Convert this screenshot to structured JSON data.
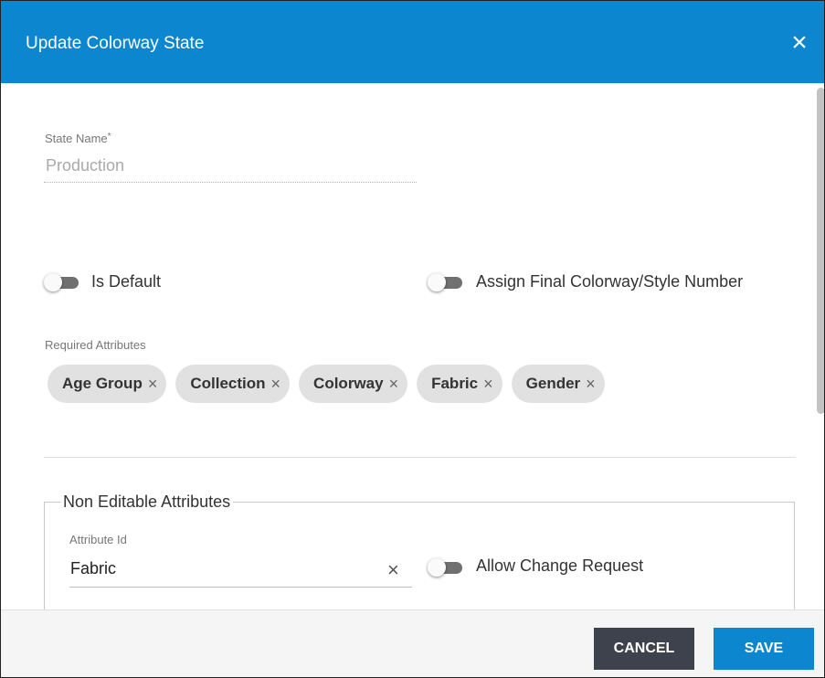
{
  "dialog": {
    "title": "Update Colorway State",
    "close_icon": "×"
  },
  "state_name": {
    "label": "State Name",
    "required_marker": "*",
    "value": "Production"
  },
  "toggles": {
    "is_default": {
      "label": "Is Default",
      "on": false
    },
    "assign_final": {
      "label": "Assign Final Colorway/Style Number",
      "on": false
    },
    "allow_change_request": {
      "label": "Allow Change Request",
      "on": false
    }
  },
  "required_attributes": {
    "label": "Required Attributes",
    "remove_icon": "×",
    "chips": [
      "Age Group",
      "Collection",
      "Colorway",
      "Fabric",
      "Gender"
    ]
  },
  "non_editable": {
    "legend": "Non Editable Attributes",
    "attribute_id_label": "Attribute Id",
    "attribute_id_value": "Fabric",
    "clear_icon": "×"
  },
  "footer": {
    "cancel_label": "CANCEL",
    "save_label": "SAVE"
  },
  "colors": {
    "primary": "#0b86cf",
    "cancel": "#3e424c"
  }
}
